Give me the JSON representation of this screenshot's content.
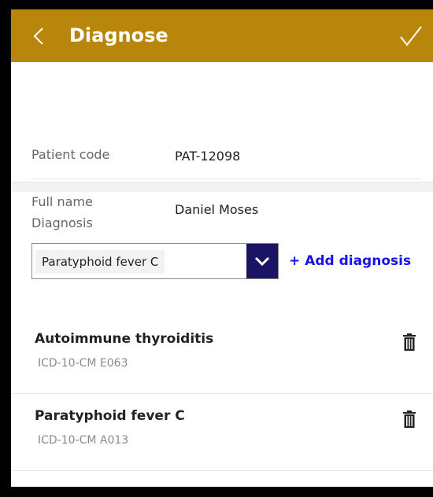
{
  "header": {
    "title": "Diagnose",
    "background_color": "#b8860b",
    "back_icon": "chevron-left-icon",
    "confirm_icon": "checkmark-icon"
  },
  "patient": {
    "code_label": "Patient code",
    "code_value": "PAT-12098",
    "name_label": "Full name",
    "name_value": "Daniel Moses"
  },
  "diagnosis_picker": {
    "label": "Diagnosis",
    "selected": "Paratyphoid fever C",
    "button_color": "#1b1464",
    "add_label": "+ Add diagnosis",
    "add_color": "#1414e6"
  },
  "diagnoses": [
    {
      "name": "Autoimmune thyroiditis",
      "code": "ICD-10-CM E063",
      "delete_icon": "trash-icon"
    },
    {
      "name": "Paratyphoid fever C",
      "code": "ICD-10-CM A013",
      "delete_icon": "trash-icon"
    }
  ]
}
